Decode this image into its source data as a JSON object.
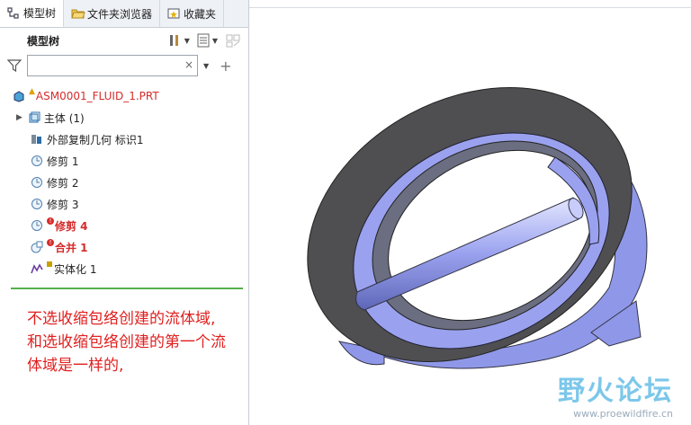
{
  "tabs": [
    {
      "label": "模型树",
      "icon": "model-tree-icon"
    },
    {
      "label": "文件夹浏览器",
      "icon": "folder-browser-icon"
    },
    {
      "label": "收藏夹",
      "icon": "favorites-icon"
    }
  ],
  "panel": {
    "title": "模型树"
  },
  "filter": {
    "value": "",
    "clear": "×"
  },
  "tree": {
    "root": "ASM0001_FLUID_1.PRT",
    "items": [
      {
        "label": "主体 (1)"
      },
      {
        "label": "外部复制几何 标识1"
      },
      {
        "label": "修剪 1"
      },
      {
        "label": "修剪 2"
      },
      {
        "label": "修剪 3"
      },
      {
        "label": "修剪 4"
      },
      {
        "label": "合并 1"
      },
      {
        "label": "实体化 1"
      }
    ]
  },
  "note": {
    "lines": [
      "不选收缩包络创建的流体域,",
      "和选收缩包络创建的第一个流",
      "体域是一样的,"
    ]
  },
  "watermark": {
    "title": "野火论坛",
    "url": "www.proewildfire.cn"
  },
  "colors": {
    "accent_red": "#d62c2c",
    "divider": "#55b04a",
    "model_blue": "#8f98e8"
  }
}
